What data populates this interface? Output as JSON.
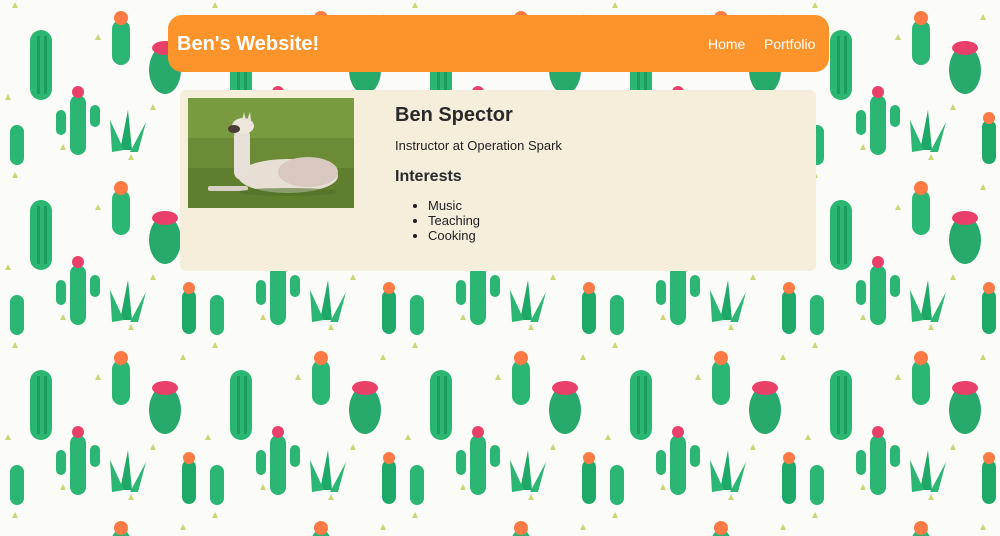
{
  "header": {
    "title": "Ben's Website!",
    "nav": [
      {
        "label": "Home"
      },
      {
        "label": "Portfolio"
      }
    ],
    "background_color": "#fd932b"
  },
  "profile": {
    "photo_icon": "llama-photo",
    "name": "Ben Spector",
    "subtitle": "Instructor at Operation Spark",
    "interests_heading": "Interests",
    "interests": [
      "Music",
      "Teaching",
      "Cooking"
    ],
    "card_color": "#f5eedb"
  },
  "background": {
    "pattern": "cactus-pattern",
    "colors": [
      "#2bb673",
      "#1e9c5e",
      "#e9406a",
      "#ff7a45",
      "#c8d36b"
    ]
  }
}
